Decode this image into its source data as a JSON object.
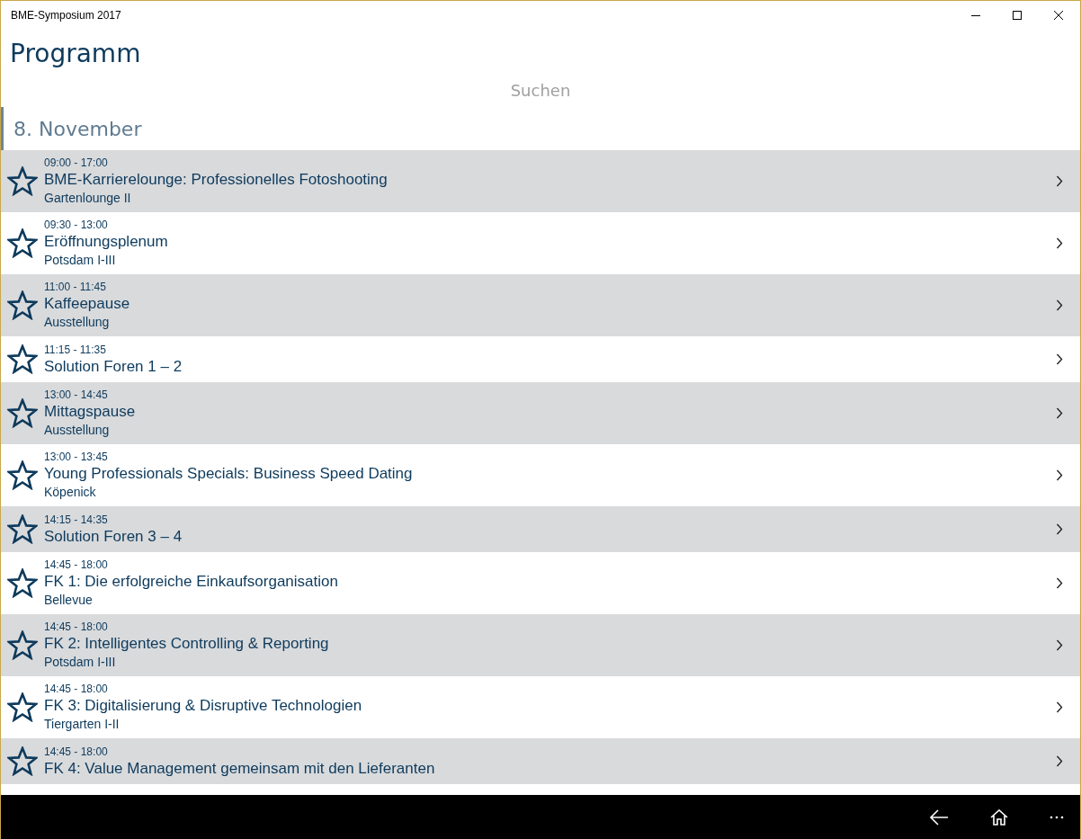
{
  "window": {
    "title": "BME-Symposium 2017"
  },
  "page": {
    "title": "Programm"
  },
  "search": {
    "placeholder": "Suchen"
  },
  "group": {
    "title": "8. November"
  },
  "sessions": [
    {
      "time": "09:00 - 17:00",
      "title": "BME-Karrierelounge: Professionelles Fotoshooting",
      "location": "Gartenlounge II",
      "favorite": false
    },
    {
      "time": "09:30 - 13:00",
      "title": "Eröffnungsplenum",
      "location": "Potsdam I-III",
      "favorite": false
    },
    {
      "time": "11:00 - 11:45",
      "title": "Kaffeepause",
      "location": "Ausstellung",
      "favorite": false
    },
    {
      "time": "11:15 - 11:35",
      "title": "Solution Foren 1 – 2",
      "favorite": false
    },
    {
      "time": "13:00 - 14:45",
      "title": "Mittagspause",
      "location": "Ausstellung",
      "favorite": false
    },
    {
      "time": "13:00 - 13:45",
      "title": "Young Professionals Specials: Business Speed Dating",
      "location": "Köpenick",
      "favorite": false
    },
    {
      "time": "14:15 - 14:35",
      "title": "Solution Foren 3 – 4",
      "favorite": false
    },
    {
      "time": "14:45 - 18:00",
      "title": "FK 1: Die erfolgreiche Einkaufsorganisation",
      "location": "Bellevue",
      "favorite": false
    },
    {
      "time": "14:45 - 18:00",
      "title": "FK 2: Intelligentes Controlling & Reporting",
      "location": "Potsdam I-III",
      "favorite": false
    },
    {
      "time": "14:45 - 18:00",
      "title": "FK 3: Digitalisierung & Disruptive Technologien",
      "location": "Tiergarten I-II",
      "favorite": false
    },
    {
      "time": "14:45 - 18:00",
      "title": "FK 4: Value Management gemeinsam mit den Lieferanten",
      "favorite": false
    }
  ]
}
